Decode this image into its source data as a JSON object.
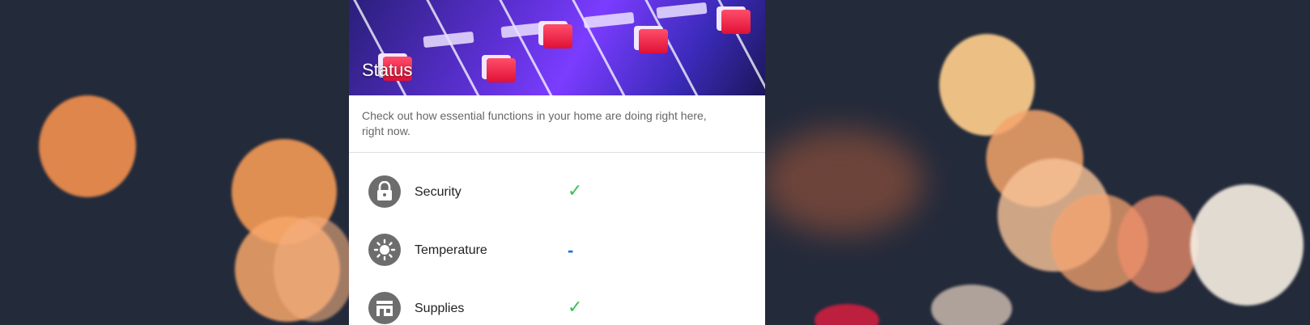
{
  "card": {
    "title": "Status",
    "description": "Check out how essential functions in your home are doing right here, right now."
  },
  "items": [
    {
      "label": "Security",
      "icon": "lock-icon",
      "status": "✓",
      "status_kind": "ok"
    },
    {
      "label": "Temperature",
      "icon": "thermostat-icon",
      "status": "-",
      "status_kind": "neutral"
    },
    {
      "label": "Supplies",
      "icon": "store-icon",
      "status": "✓",
      "status_kind": "ok"
    }
  ],
  "colors": {
    "ok": "#3bbf5a",
    "neutral": "#1e6fd8",
    "icon_bg": "#6d6d6d"
  }
}
